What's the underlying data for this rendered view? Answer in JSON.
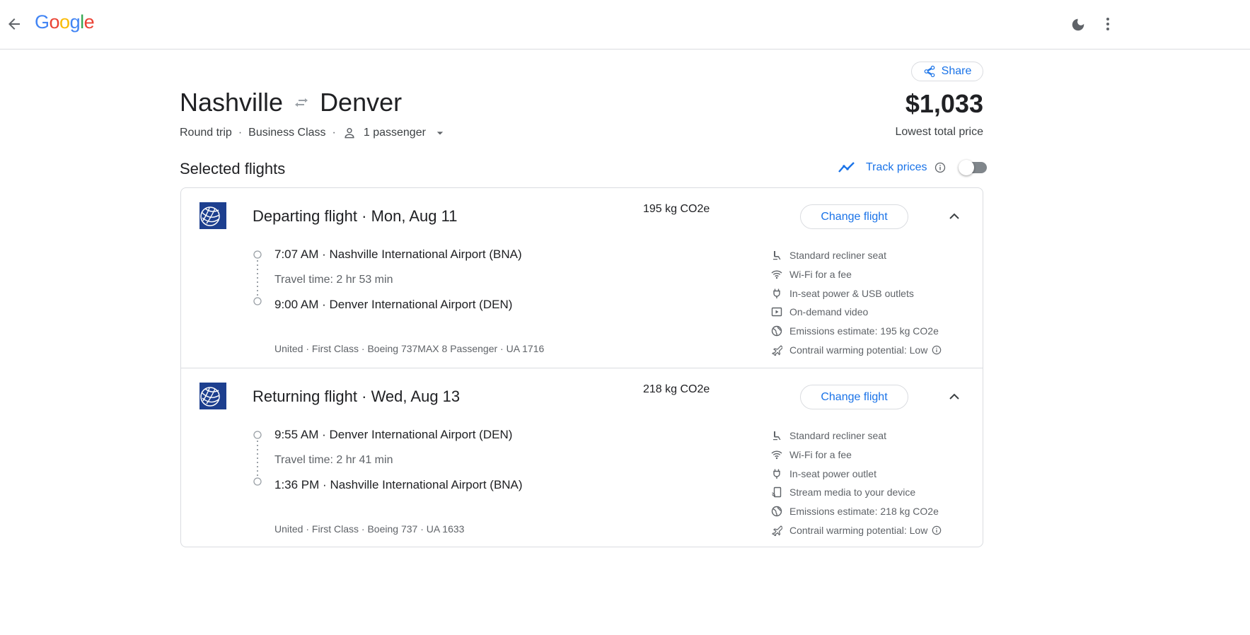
{
  "header": {
    "logo": "Google",
    "logo_colors": [
      "#4285F4",
      "#EA4335",
      "#FBBC05",
      "#4285F4",
      "#34A853",
      "#EA4335"
    ]
  },
  "trip": {
    "origin": "Nashville",
    "destination": "Denver",
    "trip_type": "Round trip",
    "cabin": "Business Class",
    "passengers": "1 passenger",
    "share_label": "Share",
    "price": "$1,033",
    "price_label": "Lowest total price"
  },
  "selected": {
    "heading": "Selected flights",
    "track_label": "Track prices",
    "track_enabled": false
  },
  "flights": [
    {
      "title": "Departing flight",
      "date": "Mon, Aug 11",
      "co2": "195 kg CO2e",
      "change_label": "Change flight",
      "depart_time": "7:07 AM",
      "depart_airport": "Nashville International Airport (BNA)",
      "travel_time": "Travel time: 2 hr 53 min",
      "arrive_time": "9:00 AM",
      "arrive_airport": "Denver International Airport (DEN)",
      "details": "United · First Class · Boeing 737MAX 8 Passenger · UA 1716",
      "amenities": [
        {
          "icon": "seat-icon",
          "label": "Standard recliner seat"
        },
        {
          "icon": "wifi-icon",
          "label": "Wi-Fi for a fee"
        },
        {
          "icon": "power-plug-icon",
          "label": "In-seat power & USB outlets"
        },
        {
          "icon": "video-icon",
          "label": "On-demand video"
        },
        {
          "icon": "globe-icon",
          "label": "Emissions estimate: 195 kg CO2e"
        },
        {
          "icon": "contrail-icon",
          "label": "Contrail warming potential: Low"
        }
      ]
    },
    {
      "title": "Returning flight",
      "date": "Wed, Aug 13",
      "co2": "218 kg CO2e",
      "change_label": "Change flight",
      "depart_time": "9:55 AM",
      "depart_airport": "Denver International Airport (DEN)",
      "travel_time": "Travel time: 2 hr 41 min",
      "arrive_time": "1:36 PM",
      "arrive_airport": "Nashville International Airport (BNA)",
      "details": "United · First Class · Boeing 737 · UA 1633",
      "amenities": [
        {
          "icon": "seat-icon",
          "label": "Standard recliner seat"
        },
        {
          "icon": "wifi-icon",
          "label": "Wi-Fi for a fee"
        },
        {
          "icon": "power-plug-icon",
          "label": "In-seat power outlet"
        },
        {
          "icon": "stream-device-icon",
          "label": "Stream media to your device"
        },
        {
          "icon": "globe-icon",
          "label": "Emissions estimate: 218 kg CO2e"
        },
        {
          "icon": "contrail-icon",
          "label": "Contrail warming potential: Low"
        }
      ]
    }
  ]
}
